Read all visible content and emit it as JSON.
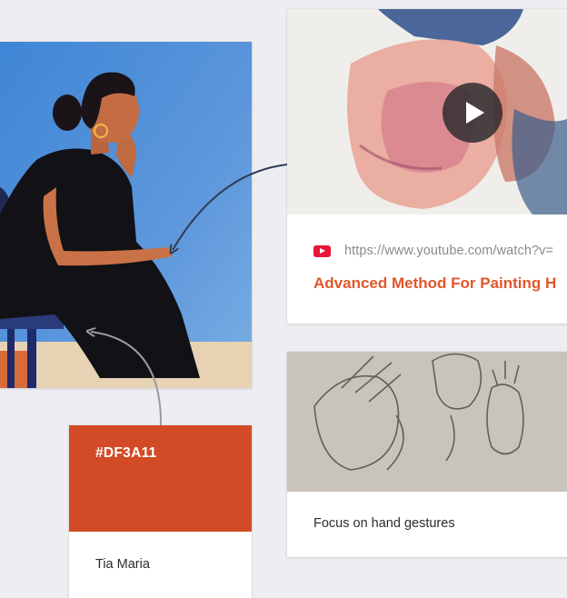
{
  "painting": {
    "icon": "woman-portrait-painting"
  },
  "video_card": {
    "url": "https://www.youtube.com/watch?v=",
    "title": "Advanced Method For Painting H",
    "source_icon": "youtube-icon",
    "play_icon": "play-icon",
    "source_color": "#e8173a",
    "title_color": "#e0572b"
  },
  "sketch_card": {
    "caption": "Focus on hand gestures"
  },
  "color_card": {
    "hex": "#DF3A11",
    "name": "Tia Maria",
    "swatch_color": "#d24b26"
  }
}
